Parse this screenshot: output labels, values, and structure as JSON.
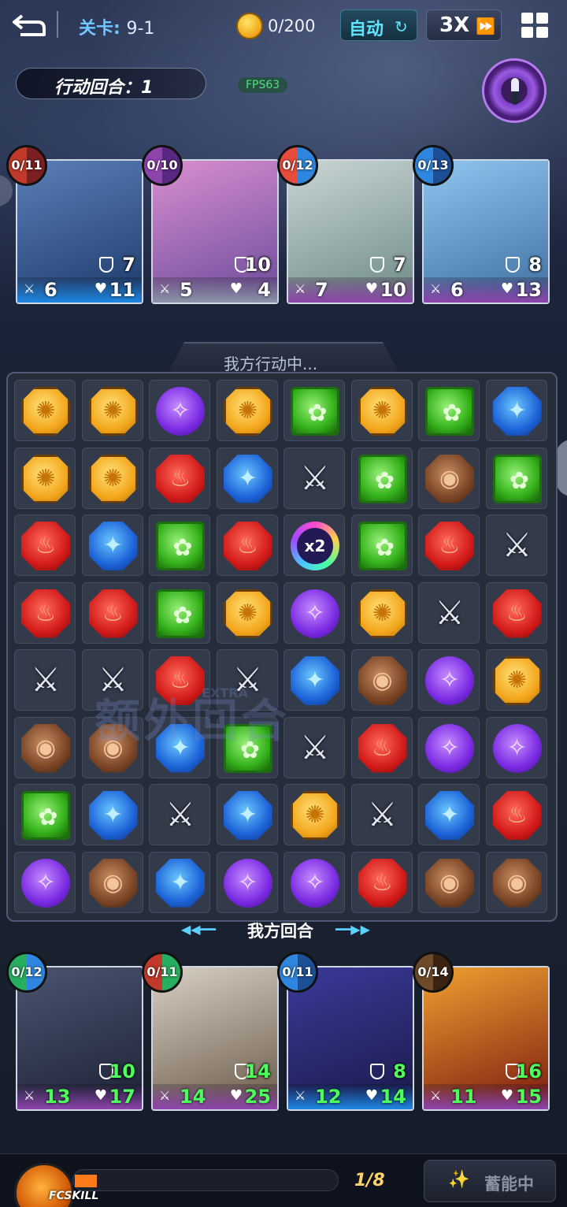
{
  "header": {
    "stage_label": "关卡:",
    "stage_value": "9-1",
    "coins": "0/200",
    "auto_label": "自动",
    "speed_label": "3X",
    "action_round": "行动回合：1",
    "fps": "FPS63"
  },
  "enemy_cards": [
    {
      "badge": "0/11",
      "shield": "7",
      "attack": "6",
      "hp": "11",
      "band": "#1e88e5",
      "badge_colors": [
        "#c0392b",
        "#7a2020"
      ],
      "art": [
        "#5b7fb8",
        "#1e3a6a"
      ]
    },
    {
      "badge": "0/10",
      "shield": "10",
      "attack": "5",
      "hp": "4",
      "band": "#8e96a8",
      "badge_colors": [
        "#8e44ad",
        "#5a2880"
      ],
      "art": [
        "#d98fd0",
        "#6a4a9a"
      ]
    },
    {
      "badge": "0/12",
      "shield": "7",
      "attack": "7",
      "hp": "10",
      "band": "#8e44ad",
      "badge_colors": [
        "#e74c3c",
        "#2e86de"
      ],
      "art": [
        "#c9d6d4",
        "#6e8a86"
      ]
    },
    {
      "badge": "0/13",
      "shield": "8",
      "attack": "6",
      "hp": "13",
      "band": "#8e44ad",
      "badge_colors": [
        "#2e86de",
        "#1c4f96"
      ],
      "art": [
        "#8fc6ef",
        "#3f6fa0"
      ]
    }
  ],
  "board": {
    "status": "我方行动中...",
    "rows": [
      [
        "sun",
        "sun",
        "void",
        "sun",
        "leaf",
        "sun",
        "leaf",
        "water"
      ],
      [
        "sun",
        "sun",
        "fire",
        "water",
        "sword",
        "leaf",
        "earth",
        "leaf"
      ],
      [
        "fire",
        "water",
        "leaf",
        "fire",
        "x2",
        "leaf",
        "fire",
        "sword"
      ],
      [
        "fire",
        "fire",
        "leaf",
        "sun",
        "void",
        "sun",
        "sword",
        "fire"
      ],
      [
        "sword",
        "sword",
        "fire",
        "sword",
        "water",
        "earth",
        "void",
        "sun"
      ],
      [
        "earth",
        "earth",
        "water",
        "leaf",
        "sword",
        "fire",
        "void",
        "void"
      ],
      [
        "leaf",
        "water",
        "sword",
        "water",
        "sun",
        "sword",
        "water",
        "fire"
      ],
      [
        "void",
        "earth",
        "water",
        "void",
        "void",
        "fire",
        "earth",
        "earth"
      ]
    ],
    "x2_label": "x2",
    "watermark": "额外回合",
    "watermark_small": "EXTRA"
  },
  "turn_banner": "我方回合",
  "player_cards": [
    {
      "badge": "0/12",
      "shield": "10",
      "attack": "13",
      "hp": "17",
      "band": "#8e44ad",
      "badge_colors": [
        "#27ae60",
        "#2e86de"
      ],
      "art": [
        "#4a5470",
        "#1c2236"
      ]
    },
    {
      "badge": "0/11",
      "shield": "14",
      "attack": "14",
      "hp": "25",
      "band": "#8e44ad",
      "badge_colors": [
        "#c0392b",
        "#27ae60"
      ],
      "art": [
        "#d8d0c4",
        "#6a5a4a"
      ]
    },
    {
      "badge": "0/11",
      "shield": "8",
      "attack": "12",
      "hp": "14",
      "band": "#1e88e5",
      "badge_colors": [
        "#2e86de",
        "#1c4f96"
      ],
      "art": [
        "#3a3a9a",
        "#1a1a4a"
      ]
    },
    {
      "badge": "0/14",
      "shield": "16",
      "attack": "11",
      "hp": "15",
      "band": "#8e44ad",
      "badge_colors": [
        "#6e4a2a",
        "#3c2412"
      ],
      "art": [
        "#f0a030",
        "#7a1a10"
      ]
    }
  ],
  "bottom": {
    "skill_label": "FCSKILL",
    "progress": "1/8",
    "progress_fraction": 0.125,
    "charge_label": "蓄能中"
  },
  "icons": {
    "gem_symbols": {
      "sun": "✺",
      "fire": "♨",
      "water": "✦",
      "leaf": "✿",
      "void": "✧",
      "earth": "◉",
      "sword": "⚔"
    }
  }
}
